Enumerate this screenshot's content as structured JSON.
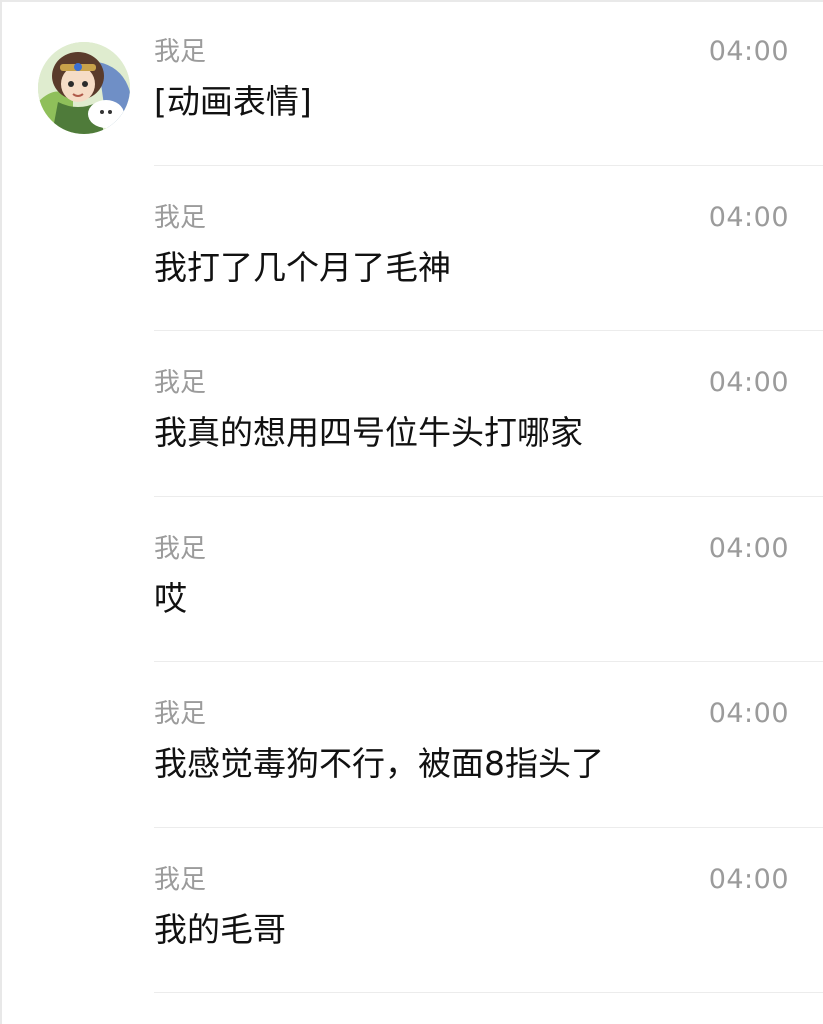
{
  "messages": [
    {
      "sender": "我足",
      "time": "04:00",
      "text": "[动画表情]",
      "avatar": "character-avatar"
    },
    {
      "sender": "我足",
      "time": "04:00",
      "text": "我打了几个月了毛神"
    },
    {
      "sender": "我足",
      "time": "04:00",
      "text": "我真的想用四号位牛头打哪家"
    },
    {
      "sender": "我足",
      "time": "04:00",
      "text": "哎"
    },
    {
      "sender": "我足",
      "time": "04:00",
      "text": "我感觉毒狗不行，被面8指头了"
    },
    {
      "sender": "我足",
      "time": "04:00",
      "text": "我的毛哥"
    }
  ]
}
